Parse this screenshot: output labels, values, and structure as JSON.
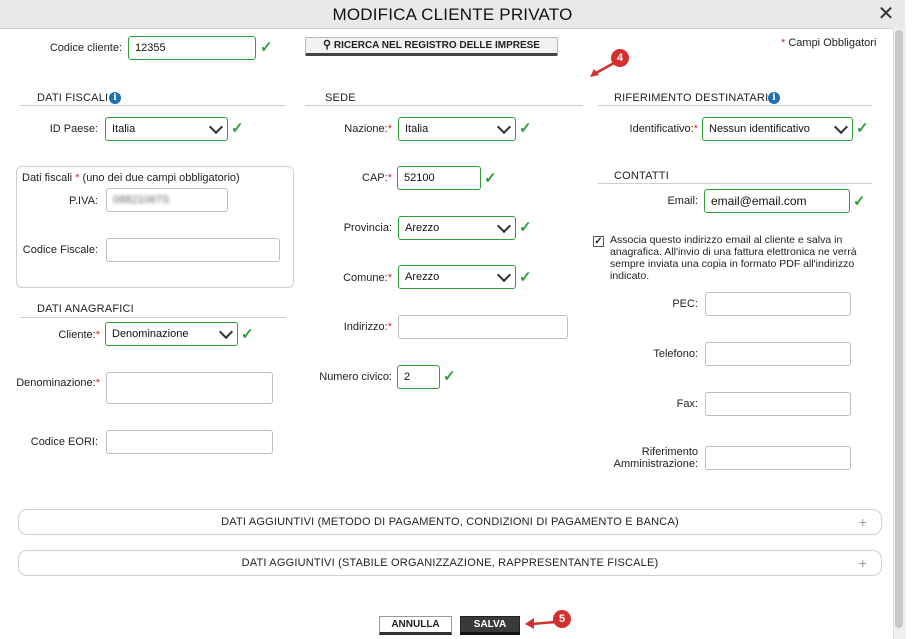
{
  "window": {
    "title": "MODIFICA CLIENTE PRIVATO",
    "close_glyph": "✕"
  },
  "top": {
    "codice_label": "Codice cliente:",
    "codice_value": "12355",
    "search_button": "RICERCA NEL REGISTRO DELLE IMPRESE",
    "required_note": "Campi Obbligatori",
    "required_star": "*"
  },
  "dati_fiscali": {
    "title": "DATI FISCALI",
    "info_glyph": "i",
    "id_paese_label": "ID Paese:",
    "id_paese_value": "Italia",
    "box_title": "Dati fiscali",
    "box_title_star": "*",
    "box_title_note": "(uno dei due campi obbligatorio)",
    "piva_label": "P.IVA:",
    "piva_value": "08821067S",
    "cf_label": "Codice Fiscale:",
    "cf_value": ""
  },
  "dati_anagrafici": {
    "title": "DATI ANAGRAFICI",
    "cliente_label": "Cliente:",
    "cliente_value": "Denominazione",
    "denominazione_label": "Denominazione:",
    "denominazione_value": "",
    "eori_label": "Codice EORI:",
    "eori_value": ""
  },
  "sede": {
    "title": "SEDE",
    "nazione_label": "Nazione:",
    "nazione_value": "Italia",
    "cap_label": "CAP:",
    "cap_value": "52100",
    "provincia_label": "Provincia:",
    "provincia_value": "Arezzo",
    "comune_label": "Comune:",
    "comune_value": "Arezzo",
    "indirizzo_label": "Indirizzo:",
    "indirizzo_value": "",
    "civico_label": "Numero civico:",
    "civico_value": "2"
  },
  "riferimento": {
    "title": "RIFERIMENTO DESTINATARIO",
    "info_glyph": "i",
    "identificativo_label": "Identificativo:",
    "identificativo_value": "Nessun identificativo"
  },
  "contatti": {
    "title": "CONTATTI",
    "email_label": "Email:",
    "email_value": "email@email.com",
    "checkbox_glyph": "✓",
    "checkbox_text": "Associa questo indirizzo email al cliente e salva in anagrafica. All'invio di una fattura elettronica ne verrà sempre inviata una copia in formato PDF all'indirizzo indicato.",
    "pec_label": "PEC:",
    "telefono_label": "Telefono:",
    "fax_label": "Fax:",
    "rif_amm_label": "Riferimento Amministrazione:"
  },
  "accordions": [
    {
      "label": "DATI AGGIUNTIVI (METODO DI PAGAMENTO, CONDIZIONI DI PAGAMENTO E BANCA)"
    },
    {
      "label": "DATI AGGIUNTIVI (STABILE ORGANIZZAZIONE, RAPPRESENTANTE FISCALE)"
    }
  ],
  "buttons": {
    "annulla": "ANNULLA",
    "salva": "SALVA"
  },
  "annotations": {
    "badge_4": "4",
    "badge_5": "5"
  },
  "glyphs": {
    "check": "✓",
    "plus": "+",
    "magnifier": "⚲"
  },
  "colors": {
    "valid": "#2e9e3a",
    "required": "#d32f2f",
    "info": "#1f6fb2",
    "annotation": "#d32f2f"
  }
}
